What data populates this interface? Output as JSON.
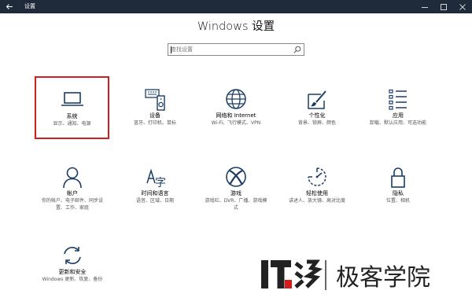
{
  "window": {
    "title": "设置"
  },
  "header": {
    "title": "Windows 设置"
  },
  "search": {
    "placeholder": "查找设置"
  },
  "tiles": [
    {
      "label": "系统",
      "sub": "显示、通知、电源",
      "icon": "laptop-icon",
      "selected": true
    },
    {
      "label": "设备",
      "sub": "蓝牙、打印机、鼠标",
      "icon": "devices-icon"
    },
    {
      "label": "网络和 Internet",
      "sub": "Wi-Fi、飞行模式、VPN",
      "icon": "globe-icon"
    },
    {
      "label": "个性化",
      "sub": "背景、锁屏、颜色",
      "icon": "brush-icon"
    },
    {
      "label": "应用",
      "sub": "卸载、默认应用、可选功能",
      "icon": "app-list-icon"
    },
    {
      "label": "帐户",
      "sub": "你的帐户、电子邮件、同步设置、工作、家庭",
      "icon": "person-icon"
    },
    {
      "label": "时间和语言",
      "sub": "语音、区域、日期",
      "icon": "time-language-icon"
    },
    {
      "label": "游戏",
      "sub": "游戏栏、DVR、广播、游戏模式",
      "icon": "xbox-icon"
    },
    {
      "label": "轻松使用",
      "sub": "讲述人、放大镜、高对比度",
      "icon": "ease-of-access-icon"
    },
    {
      "label": "隐私",
      "sub": "位置、相机",
      "icon": "lock-icon"
    },
    {
      "label": "更新和安全",
      "sub": "Windows 更新、恢复、备份",
      "icon": "update-icon"
    }
  ],
  "watermark": {
    "text": "IT之家 极客学院"
  }
}
